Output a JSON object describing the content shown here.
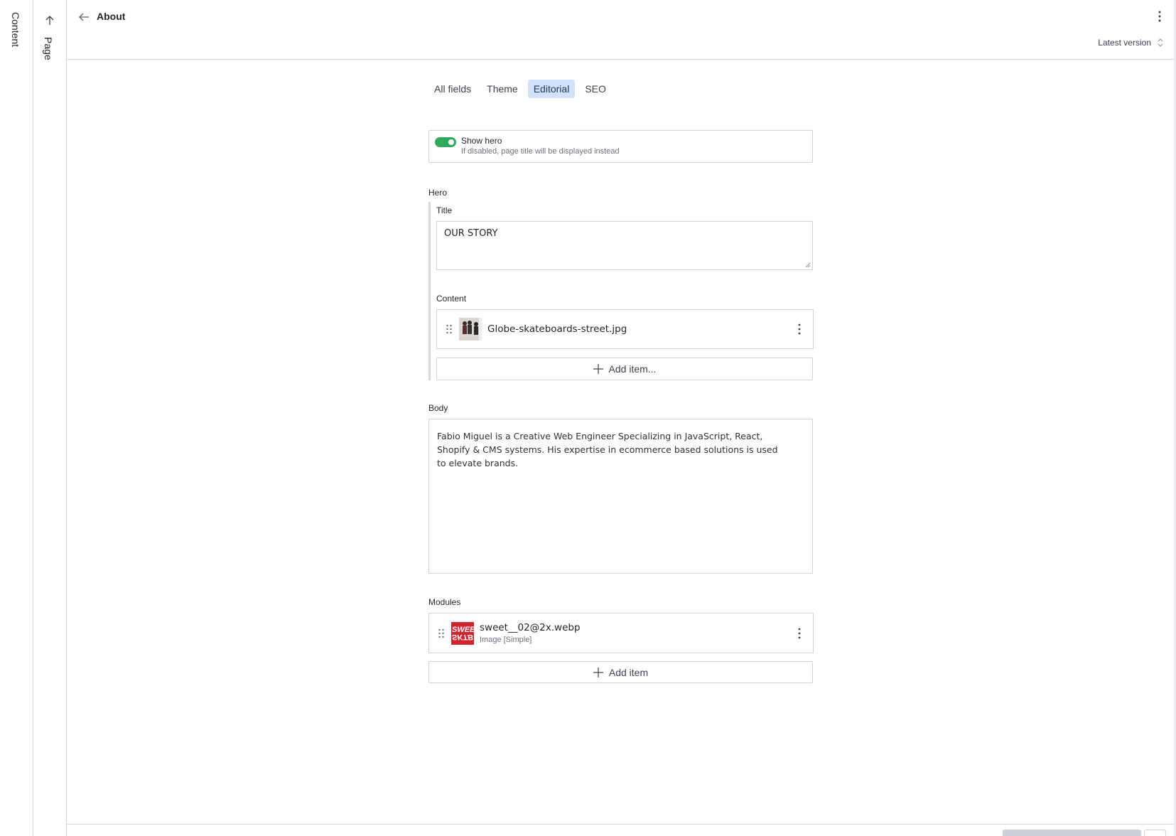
{
  "rails": {
    "content_label": "Content",
    "page_label": "Page"
  },
  "header": {
    "title": "About",
    "version_label": "Latest version"
  },
  "tabs": [
    {
      "label": "All fields",
      "active": false
    },
    {
      "label": "Theme",
      "active": false
    },
    {
      "label": "Editorial",
      "active": true
    },
    {
      "label": "SEO",
      "active": false
    }
  ],
  "show_hero": {
    "label": "Show hero",
    "help": "If disabled, page title will be displayed instead",
    "enabled": true
  },
  "hero": {
    "label": "Hero",
    "title_label": "Title",
    "title_value": "OUR STORY",
    "content_label": "Content",
    "content_items": [
      {
        "name": "Globe-skateboards-street.jpg"
      }
    ],
    "add_item_label": "Add item..."
  },
  "body": {
    "label": "Body",
    "value": "Fabio Miguel is a Creative Web Engineer Specializing in JavaScript, React, Shopify & CMS systems. His expertise in ecommerce based solutions is used to elevate brands."
  },
  "modules": {
    "label": "Modules",
    "items": [
      {
        "name": "sweet__02@2x.webp",
        "type": "Image [Simple]"
      }
    ],
    "add_item_label": "Add item"
  },
  "colors": {
    "accent_tab_bg": "#d3e2fb",
    "toggle_on": "#2eaa5c",
    "thumb_red": "#d3232f"
  }
}
